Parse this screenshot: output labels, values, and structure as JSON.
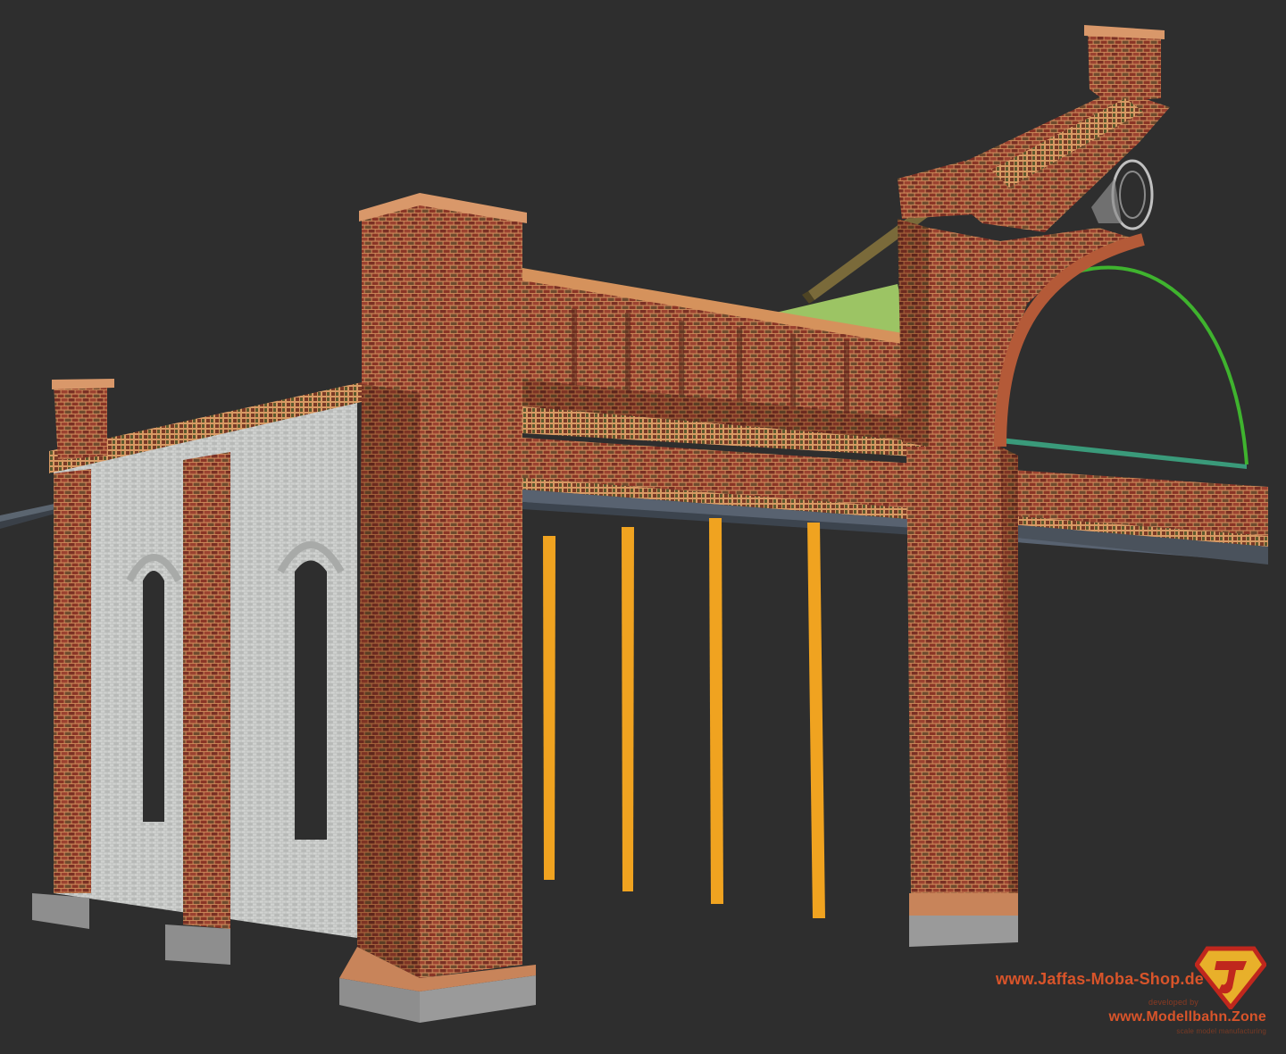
{
  "scene": {
    "subject": "brick-railway-gatehouse-3d-model",
    "colors": {
      "background": "#2e2e2e",
      "brick": "#8c3a28",
      "mortar": "#c98a5a",
      "plaster": "#c9cbc9",
      "column": "#f0a320",
      "roof_green": "#9cc464",
      "arc_line": "#3fb32e",
      "base_stone": "#9a9a9a"
    }
  },
  "credits": {
    "shop_url": "www.Jaffas-Moba-Shop.de",
    "developed_by": "developed by",
    "dev_url": "www.Modellbahn.Zone",
    "tagline": "scale model manufacturing"
  },
  "logo": {
    "icon": "superman-j-shield-logo",
    "letter": "J"
  }
}
